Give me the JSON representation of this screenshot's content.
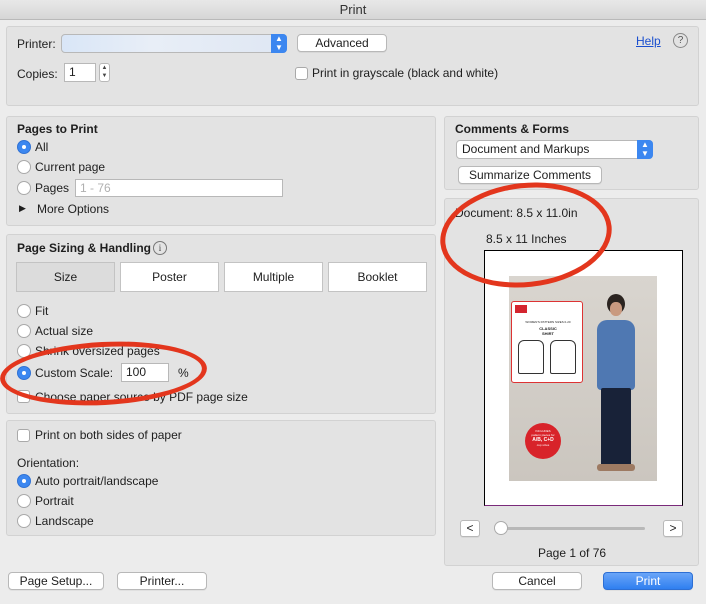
{
  "window": {
    "title": "Print"
  },
  "top": {
    "printer_label": "Printer:",
    "advanced_label": "Advanced",
    "help_label": "Help",
    "help_icon": "?",
    "copies_label": "Copies:",
    "copies_value": "1",
    "grayscale_label": "Print in grayscale (black and white)"
  },
  "pages": {
    "title": "Pages to Print",
    "all": "All",
    "current": "Current page",
    "pages": "Pages",
    "range_placeholder": "1 - 76",
    "more_options": "More Options",
    "selected": "All"
  },
  "sizing": {
    "title": "Page Sizing & Handling",
    "info_icon": "i",
    "tabs": [
      "Size",
      "Poster",
      "Multiple",
      "Booklet"
    ],
    "active_tab": "Size",
    "fit": "Fit",
    "actual": "Actual size",
    "shrink": "Shrink oversized pages",
    "custom": "Custom Scale:",
    "custom_value": "100",
    "percent": "%",
    "paper_source": "Choose paper source by PDF page size",
    "selected": "Custom Scale"
  },
  "orientation": {
    "both_sides": "Print on both sides of paper",
    "title": "Orientation:",
    "auto": "Auto portrait/landscape",
    "portrait": "Portrait",
    "landscape": "Landscape",
    "selected": "Auto portrait/landscape"
  },
  "comments": {
    "title": "Comments & Forms",
    "select_value": "Document and Markups",
    "summarize": "Summarize Comments"
  },
  "preview": {
    "document_size": "Document: 8.5 x 11.0in",
    "paper_size": "8.5 x 11 Inches",
    "prev": "<",
    "next": ">",
    "page_status": "Page 1 of 76",
    "card_lines": [
      "WOMEN'S PATTERN SIZES 0-20",
      "CLASSIC",
      "SHIRT"
    ],
    "badge_lines": [
      "INCLUDES",
      "pattern pieces for",
      "A/B, C+D",
      "cup sizes"
    ]
  },
  "bottom": {
    "page_setup": "Page Setup...",
    "printer": "Printer...",
    "cancel": "Cancel",
    "print": "Print"
  },
  "colors": {
    "accent": "#3c87f0",
    "annotation": "#e3361d"
  }
}
